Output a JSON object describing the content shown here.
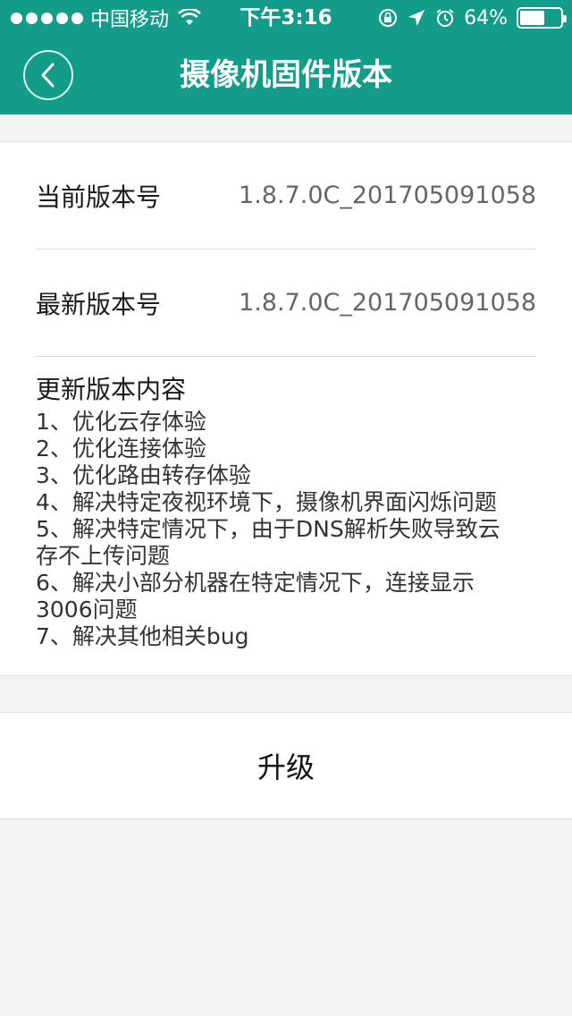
{
  "status_bar": {
    "carrier": "中国移动",
    "time": "下午3:16",
    "battery_percent": "64%",
    "battery_level": 0.64,
    "icons": [
      "signal-dots",
      "wifi-icon",
      "rotation-lock-icon",
      "location-icon",
      "alarm-icon",
      "battery-icon"
    ]
  },
  "nav": {
    "title": "摄像机固件版本",
    "back_icon": "chevron-left-icon"
  },
  "info": {
    "current_version_label": "当前版本号",
    "current_version_value": "1.8.7.0C_201705091058",
    "latest_version_label": "最新版本号",
    "latest_version_value": "1.8.7.0C_201705091058"
  },
  "release_notes": {
    "title": "更新版本内容",
    "lines": [
      "1、优化云存体验",
      "2、优化连接体验",
      "3、优化路由转存体验",
      "4、解决特定夜视环境下，摄像机界面闪烁问题",
      "5、解决特定情况下，由于DNS解析失败导致云",
      "存不上传问题",
      "6、解决小部分机器在特定情况下，连接显示",
      "3006问题",
      "7、解决其他相关bug"
    ]
  },
  "actions": {
    "upgrade_label": "升级"
  },
  "colors": {
    "header": "#139c8a",
    "background": "#f4f4f4"
  }
}
